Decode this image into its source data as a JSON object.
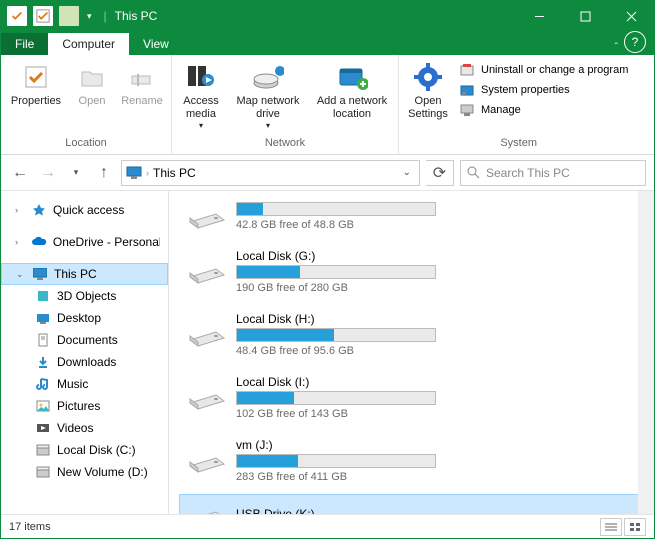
{
  "title": "This PC",
  "tabs": {
    "file": "File",
    "computer": "Computer",
    "view": "View"
  },
  "ribbon": {
    "location": {
      "label": "Location",
      "properties": "Properties",
      "open": "Open",
      "rename": "Rename"
    },
    "network": {
      "label": "Network",
      "access_media": "Access media",
      "map_drive": "Map network drive",
      "add_location": "Add a network location"
    },
    "system": {
      "label": "System",
      "open_settings": "Open Settings",
      "uninstall": "Uninstall or change a program",
      "sysprops": "System properties",
      "manage": "Manage"
    }
  },
  "address": {
    "location": "This PC"
  },
  "search": {
    "placeholder": "Search This PC"
  },
  "sidebar": {
    "quick_access": "Quick access",
    "onedrive": "OneDrive - Personal",
    "this_pc": "This PC",
    "children": [
      "3D Objects",
      "Desktop",
      "Documents",
      "Downloads",
      "Music",
      "Pictures",
      "Videos",
      "Local Disk (C:)",
      "New Volume (D:)"
    ]
  },
  "drives": [
    {
      "name": "",
      "free": "42.8 GB free of 48.8 GB",
      "fill": 13
    },
    {
      "name": "Local Disk (G:)",
      "free": "190 GB free of 280 GB",
      "fill": 32
    },
    {
      "name": "Local Disk (H:)",
      "free": "48.4 GB free of 95.6 GB",
      "fill": 49
    },
    {
      "name": "Local Disk (I:)",
      "free": "102 GB free of 143 GB",
      "fill": 29
    },
    {
      "name": "vm (J:)",
      "free": "283 GB free of 411 GB",
      "fill": 31
    },
    {
      "name": "USB Drive (K:)",
      "free": "",
      "fill": null,
      "selected": true
    }
  ],
  "status": {
    "count": "17 items"
  }
}
